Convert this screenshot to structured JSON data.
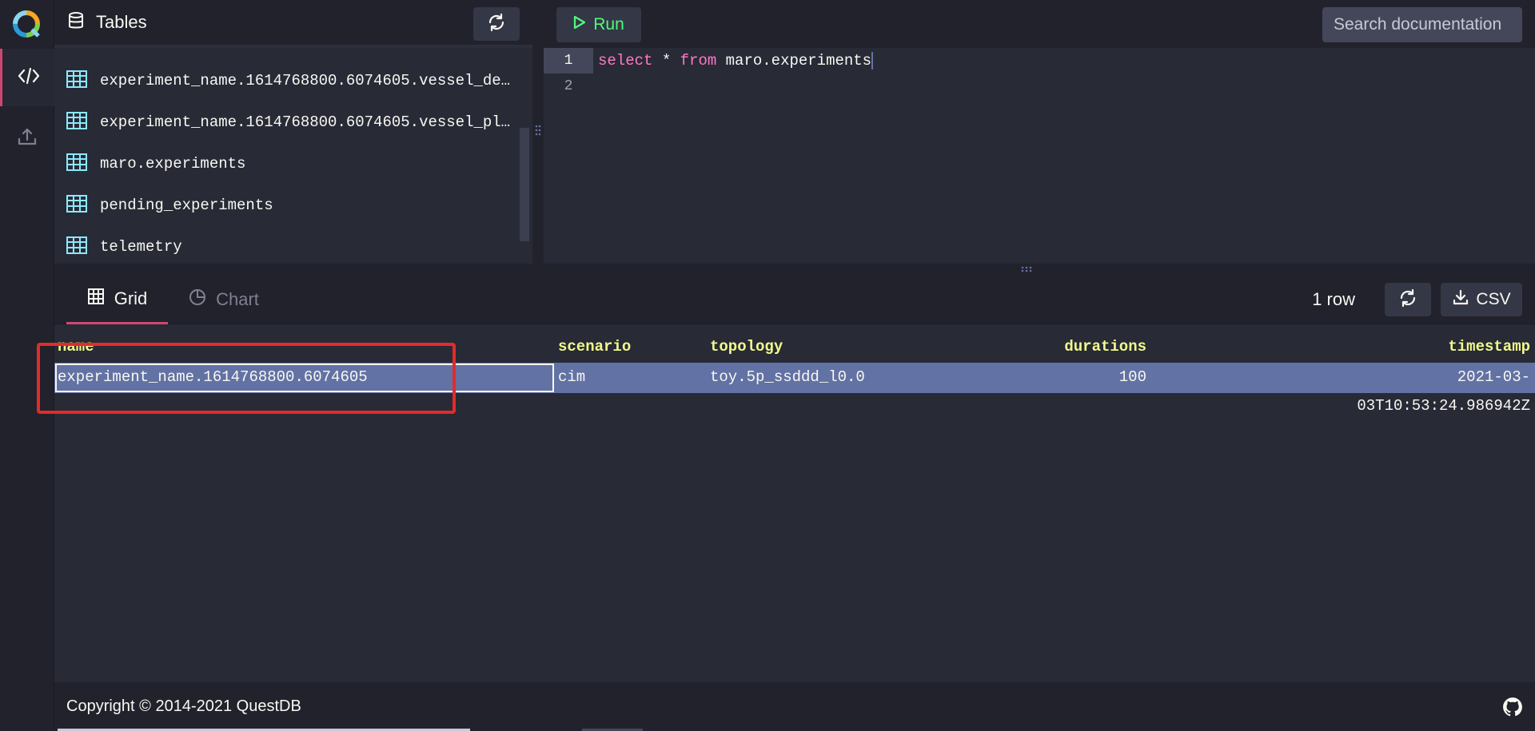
{
  "sidebar": {
    "logo_icon": "questdb-logo-icon",
    "items": [
      {
        "icon": "code-icon",
        "active": true
      },
      {
        "icon": "upload-icon",
        "active": false
      }
    ]
  },
  "tables": {
    "title": "Tables",
    "items": [
      "experiment_name.1614768800.6074605.vessel_de…",
      "experiment_name.1614768800.6074605.vessel_pl…",
      "maro.experiments",
      "pending_experiments",
      "telemetry"
    ]
  },
  "editor": {
    "run_label": "Run",
    "search_placeholder": "Search documentation",
    "line_numbers": [
      "1",
      "2"
    ],
    "code": {
      "kw1": "select",
      "star": " * ",
      "kw2": "from",
      "rest": " maro.experiments"
    }
  },
  "results": {
    "tabs": {
      "grid": "Grid",
      "chart": "Chart"
    },
    "row_count": "1 row",
    "csv_label": "CSV",
    "columns": [
      "name",
      "scenario",
      "topology",
      "durations",
      "timestamp"
    ],
    "rows": [
      [
        "experiment_name.1614768800.6074605",
        "cim",
        "toy.5p_ssddd_l0.0",
        "100",
        "2021-03-03T10:53:24.986942Z"
      ]
    ]
  },
  "footer": {
    "copyright": "Copyright © 2014-2021 QuestDB"
  },
  "colors": {
    "accent": "#d14671",
    "run_green": "#50fa7b",
    "header_yellow": "#f1fa8c",
    "selected_row": "#6272a4",
    "highlight_red": "#e32b2b"
  }
}
